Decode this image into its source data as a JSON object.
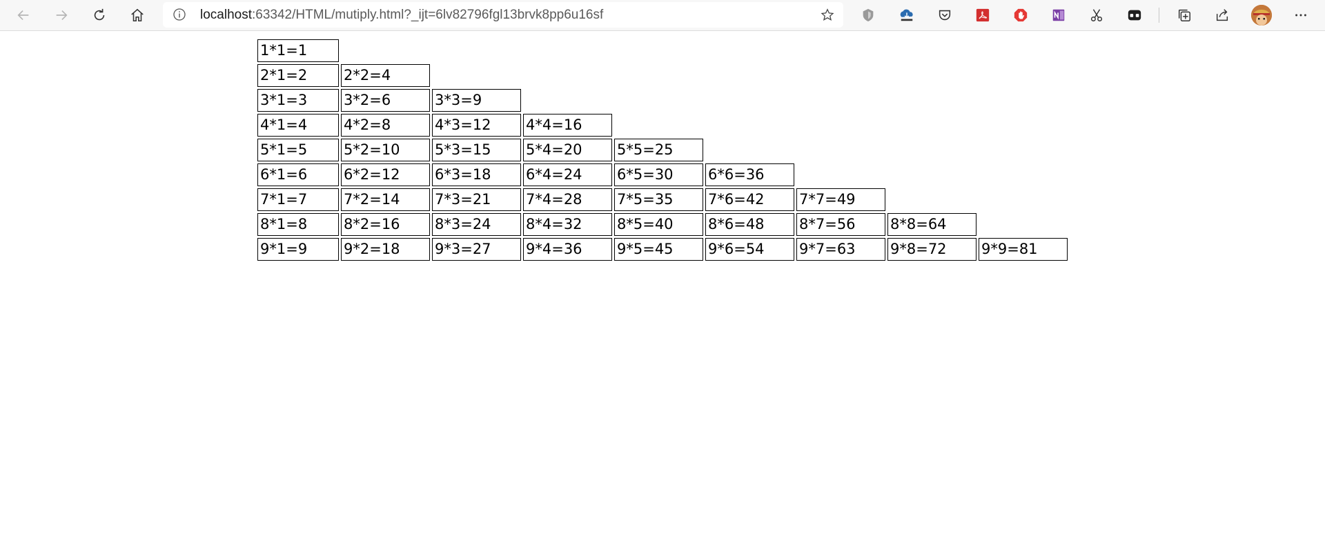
{
  "browser": {
    "url_host": "localhost",
    "url_rest": ":63342/HTML/mutiply.html?_ijt=6lv82796fgl13brvk8pp6u16sf",
    "nav_icons": [
      "back-icon",
      "forward-icon",
      "refresh-icon",
      "home-icon"
    ],
    "extension_icons": [
      "shield-extension-icon",
      "download-extension-icon",
      "pocket-icon",
      "pdf-extension-icon",
      "adblock-icon",
      "onenote-icon",
      "scissors-icon",
      "mask-extension-icon",
      "collections-icon",
      "share-icon"
    ],
    "more_menu_icon": "more-icon"
  },
  "table": {
    "rows": [
      [
        "1*1=1"
      ],
      [
        "2*1=2",
        "2*2=4"
      ],
      [
        "3*1=3",
        "3*2=6",
        "3*3=9"
      ],
      [
        "4*1=4",
        "4*2=8",
        "4*3=12",
        "4*4=16"
      ],
      [
        "5*1=5",
        "5*2=10",
        "5*3=15",
        "5*4=20",
        "5*5=25"
      ],
      [
        "6*1=6",
        "6*2=12",
        "6*3=18",
        "6*4=24",
        "6*5=30",
        "6*6=36"
      ],
      [
        "7*1=7",
        "7*2=14",
        "7*3=21",
        "7*4=28",
        "7*5=35",
        "7*6=42",
        "7*7=49"
      ],
      [
        "8*1=8",
        "8*2=16",
        "8*3=24",
        "8*4=32",
        "8*5=40",
        "8*6=48",
        "8*7=56",
        "8*8=64"
      ],
      [
        "9*1=9",
        "9*2=18",
        "9*3=27",
        "9*4=36",
        "9*5=45",
        "9*6=54",
        "9*7=63",
        "9*8=72",
        "9*9=81"
      ]
    ]
  }
}
